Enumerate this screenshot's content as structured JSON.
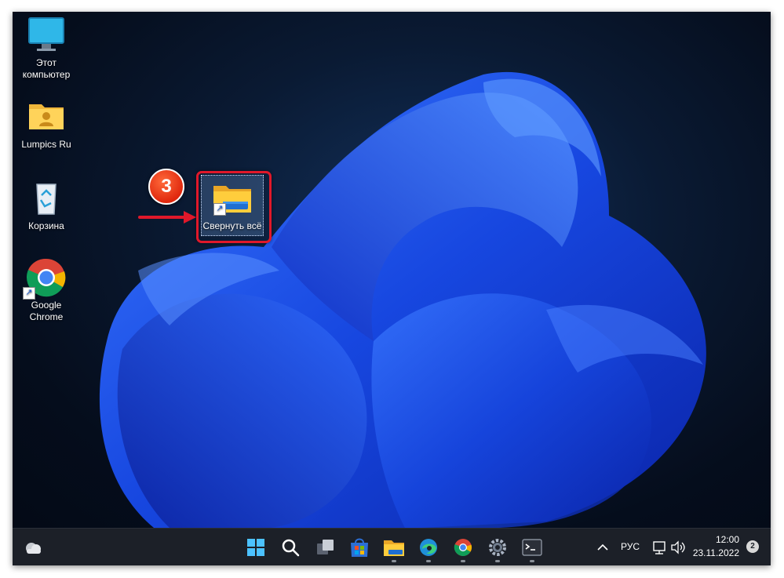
{
  "desktop": {
    "icons": [
      {
        "label": "Этот\nкомпьютер",
        "line1": "Этот",
        "line2": "компьютер",
        "icon": "monitor-icon"
      },
      {
        "label": "Lumpics Ru",
        "line1": "Lumpics Ru",
        "line2": "",
        "icon": "user-folder-icon"
      },
      {
        "label": "Корзина",
        "line1": "Корзина",
        "line2": "",
        "icon": "recycle-bin-icon"
      },
      {
        "label": "Google Chrome",
        "line1": "Google",
        "line2": "Chrome",
        "icon": "chrome-icon"
      }
    ],
    "selected_icon": {
      "label": "Свернуть всё",
      "icon": "file-explorer-folder-icon"
    },
    "annotation": {
      "step": "3",
      "color": "#e0182a"
    }
  },
  "taskbar": {
    "widgets_icon": "weather-widget-icon",
    "apps": [
      {
        "name": "start",
        "icon": "windows-start-icon"
      },
      {
        "name": "search",
        "icon": "search-icon"
      },
      {
        "name": "task-view",
        "icon": "task-view-icon"
      },
      {
        "name": "store",
        "icon": "microsoft-store-icon"
      },
      {
        "name": "file-explorer",
        "icon": "file-explorer-icon"
      },
      {
        "name": "edge",
        "icon": "edge-icon"
      },
      {
        "name": "chrome",
        "icon": "chrome-icon"
      },
      {
        "name": "settings",
        "icon": "gear-icon"
      },
      {
        "name": "terminal",
        "icon": "terminal-icon"
      }
    ],
    "tray": {
      "language": "РУС",
      "time": "12:00",
      "date": "23.11.2022",
      "notifications": "2"
    }
  },
  "colors": {
    "accent": "#1f5ff5",
    "taskbar": "#1c2028"
  }
}
